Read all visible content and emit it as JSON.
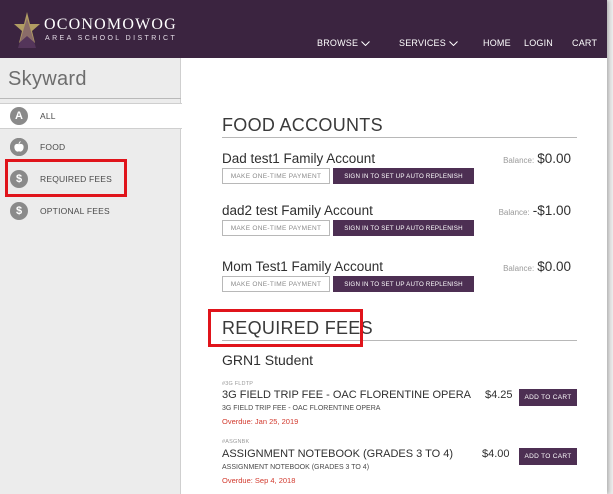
{
  "header": {
    "logo_name": "OCONOMOWOG",
    "logo_sub": "AREA SCHOOL DISTRICT",
    "nav": [
      {
        "label": "BROWSE",
        "has_dropdown": true
      },
      {
        "label": "SERVICES",
        "has_dropdown": true
      },
      {
        "label": "HOME",
        "has_dropdown": false
      },
      {
        "label": "LOGIN",
        "has_dropdown": false
      },
      {
        "label": "CART",
        "has_dropdown": false
      }
    ]
  },
  "sidebar": {
    "brand": "Skyward",
    "items": [
      {
        "label": "ALL",
        "icon_text": "A",
        "icon": "letter-a-icon",
        "active": true
      },
      {
        "label": "FOOD",
        "icon_text": "",
        "icon": "apple-icon",
        "active": false
      },
      {
        "label": "REQUIRED FEES",
        "icon_text": "$",
        "icon": "dollar-icon",
        "active": false
      },
      {
        "label": "OPTIONAL FEES",
        "icon_text": "$",
        "icon": "dollar-icon",
        "active": false
      }
    ]
  },
  "food": {
    "title": "FOOD ACCOUNTS",
    "balance_label": "Balance:",
    "one_time_label": "MAKE ONE-TIME PAYMENT",
    "auto_label": "SIGN IN TO SET UP AUTO REPLENISH",
    "accounts": [
      {
        "name": "Dad test1 Family Account",
        "balance": "$0.00"
      },
      {
        "name": "dad2 test Family Account",
        "balance": "-$1.00"
      },
      {
        "name": "Mom Test1 Family Account",
        "balance": "$0.00"
      }
    ]
  },
  "required": {
    "title": "REQUIRED FEES",
    "student": "GRN1 Student",
    "add_label": "ADD TO CART",
    "fees": [
      {
        "code": "#3G FLDTP",
        "title": "3G FIELD TRIP FEE - OAC FLORENTINE OPERA",
        "desc": "3G FIELD TRIP FEE - OAC FLORENTINE OPERA",
        "due": "Overdue: Jan 25, 2019",
        "amount": "$4.25"
      },
      {
        "code": "#ASGNBK",
        "title": "ASSIGNMENT NOTEBOOK (GRADES 3 TO 4)",
        "desc": "ASSIGNMENT NOTEBOOK (GRADES 3 TO 4)",
        "due": "Overdue: Sep 4, 2018",
        "amount": "$4.00"
      }
    ]
  },
  "colors": {
    "header_bg": "#3b2440",
    "button_bg": "#4d2f53",
    "highlight": "#e0141b",
    "overdue": "#d23a2e"
  }
}
